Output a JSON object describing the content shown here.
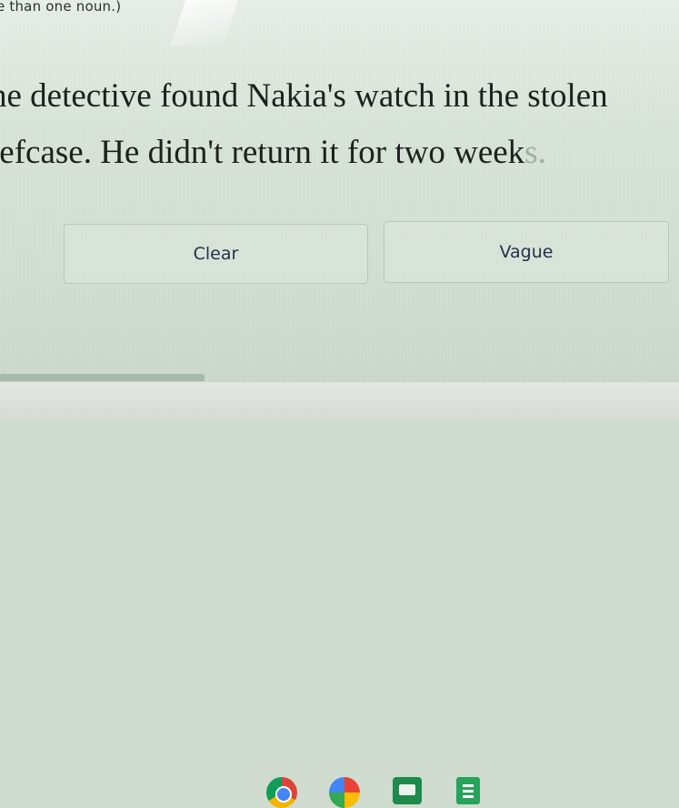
{
  "question": {
    "instruction": "e than one noun.)",
    "line1": "he detective found Nakia's watch in the stolen",
    "line2_main": "iefcase. He didn't return it for two week",
    "line2_tail": "s."
  },
  "choices": [
    {
      "label": "Clear"
    },
    {
      "label": "Vague"
    }
  ],
  "shelf": {
    "icons": [
      "chrome-icon",
      "photos-icon",
      "classroom-icon",
      "docs-icon"
    ]
  }
}
